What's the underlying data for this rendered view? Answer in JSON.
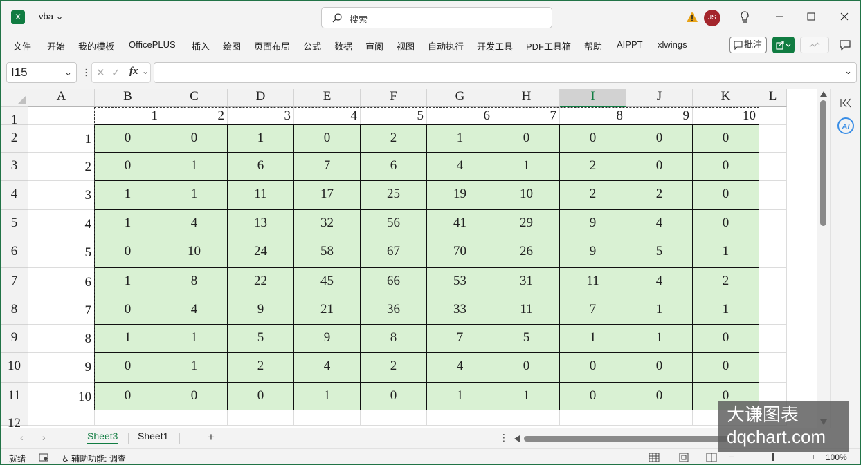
{
  "title_bar": {
    "app_icon_letter": "X",
    "file_name": "vba",
    "search_placeholder": "搜索",
    "avatar_initials": "JS"
  },
  "menu": {
    "items": [
      "文件",
      "开始",
      "我的模板",
      "OfficePLUS",
      "插入",
      "绘图",
      "页面布局",
      "公式",
      "数据",
      "审阅",
      "视图",
      "自动执行",
      "开发工具",
      "PDF工具箱",
      "帮助",
      "AIPPT",
      "xlwings"
    ],
    "comment_button": "批注"
  },
  "formula_bar": {
    "name_box": "I15",
    "fx_label": "fx",
    "formula_value": ""
  },
  "grid": {
    "columns": [
      "A",
      "B",
      "C",
      "D",
      "E",
      "F",
      "G",
      "H",
      "I",
      "J",
      "K",
      "L"
    ],
    "selected_column": "I",
    "rows": [
      "1",
      "2",
      "3",
      "4",
      "5",
      "6",
      "7",
      "8",
      "9",
      "10",
      "11",
      "12"
    ],
    "header_row_values": [
      "1",
      "2",
      "3",
      "4",
      "5",
      "6",
      "7",
      "8",
      "9",
      "10"
    ],
    "row_labels": [
      "1",
      "2",
      "3",
      "4",
      "5",
      "6",
      "7",
      "8",
      "9",
      "10"
    ],
    "matrix": [
      [
        "0",
        "0",
        "1",
        "0",
        "2",
        "1",
        "0",
        "0",
        "0",
        "0"
      ],
      [
        "0",
        "1",
        "6",
        "7",
        "6",
        "4",
        "1",
        "2",
        "0",
        "0"
      ],
      [
        "1",
        "1",
        "11",
        "17",
        "25",
        "19",
        "10",
        "2",
        "2",
        "0"
      ],
      [
        "1",
        "4",
        "13",
        "32",
        "56",
        "41",
        "29",
        "9",
        "4",
        "0"
      ],
      [
        "0",
        "10",
        "24",
        "58",
        "67",
        "70",
        "26",
        "9",
        "5",
        "1"
      ],
      [
        "1",
        "8",
        "22",
        "45",
        "66",
        "53",
        "31",
        "11",
        "4",
        "2"
      ],
      [
        "0",
        "4",
        "9",
        "21",
        "36",
        "33",
        "11",
        "7",
        "1",
        "1"
      ],
      [
        "1",
        "1",
        "5",
        "9",
        "8",
        "7",
        "5",
        "1",
        "1",
        "0"
      ],
      [
        "0",
        "1",
        "2",
        "4",
        "2",
        "4",
        "0",
        "0",
        "0",
        "0"
      ],
      [
        "0",
        "0",
        "0",
        "1",
        "0",
        "1",
        "1",
        "0",
        "0",
        "0"
      ]
    ],
    "data_fill_color": "#d9f1d3"
  },
  "sheets": {
    "tabs": [
      "Sheet3",
      "Sheet1"
    ],
    "active": "Sheet3"
  },
  "status_bar": {
    "ready": "就绪",
    "accessibility": "辅助功能: 调查",
    "zoom": "100%"
  },
  "watermark": {
    "line1": "大谦图表",
    "line2": "dqchart.com"
  },
  "colors": {
    "excel_green": "#107c41",
    "avatar_red": "#a4262c"
  }
}
